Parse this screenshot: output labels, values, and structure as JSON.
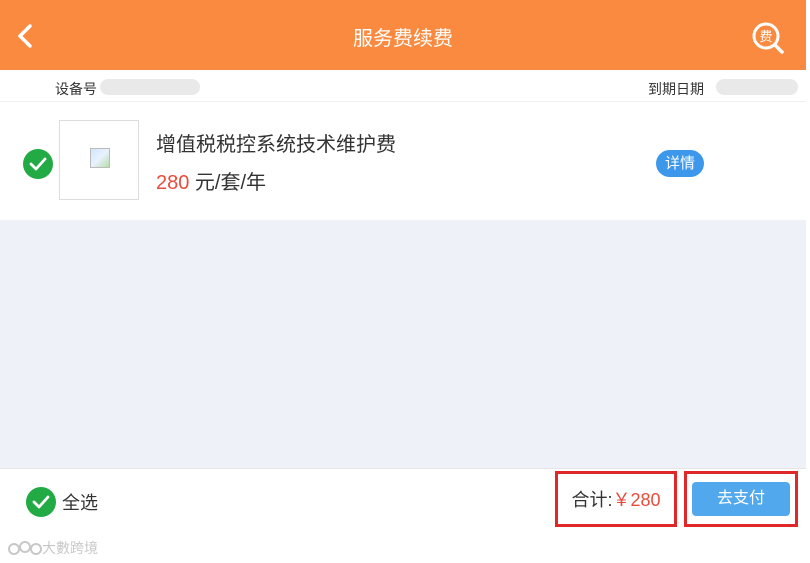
{
  "header": {
    "title": "服务费续费",
    "back_icon": "chevron-left-icon",
    "fee_icon": "fee-search-icon",
    "fee_icon_text": "费",
    "color": "#f98a3f"
  },
  "meta": {
    "device_label": "设备号",
    "expiry_label": "到期日期"
  },
  "item": {
    "name": "增值税税控系统技术维护费",
    "price": "280",
    "unit": " 元/套/年",
    "detail_label": "详情",
    "checked": true
  },
  "footer": {
    "select_all_label": "全选",
    "total_label": "合计:",
    "total_value": "￥280",
    "pay_label": "去支付"
  },
  "watermark": {
    "text": "大數跨境"
  },
  "colors": {
    "accent": "#f98a3f",
    "price_red": "#e84c3d",
    "check_green": "#22aa44",
    "button_blue": "#52a8ec",
    "highlight_red": "#e02828"
  }
}
